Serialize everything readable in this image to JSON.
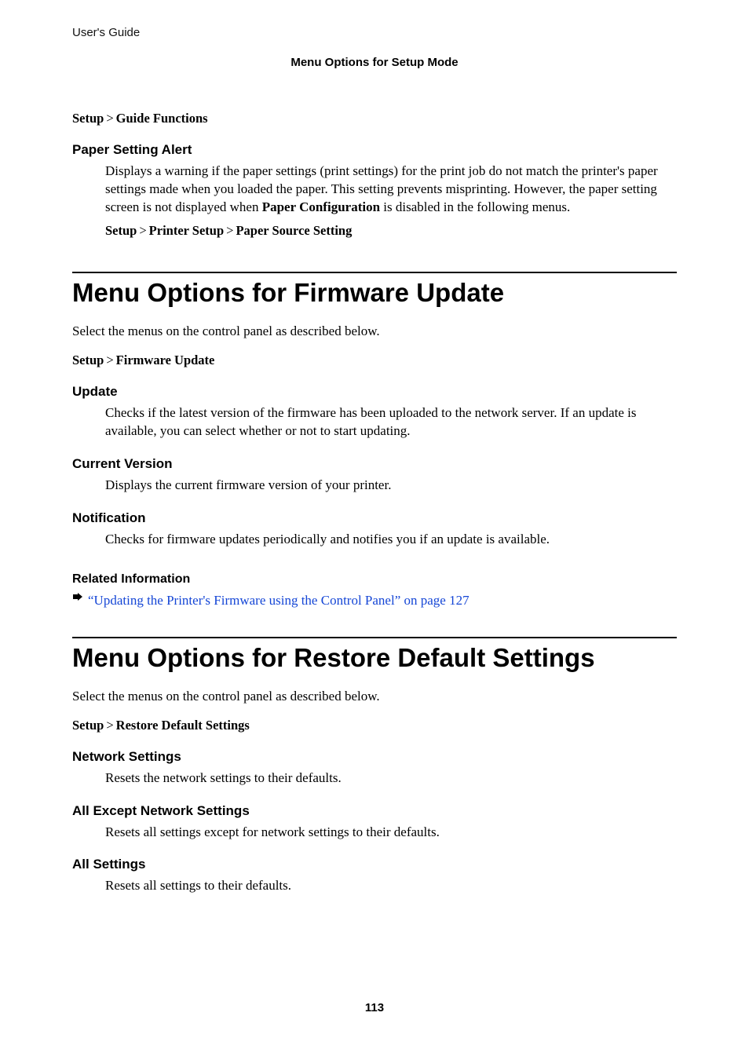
{
  "header": {
    "left": "User's Guide",
    "center": "Menu Options for Setup Mode"
  },
  "section0": {
    "path": {
      "a": "Setup",
      "b": "Guide Functions"
    },
    "item": {
      "title": "Paper Setting Alert",
      "body": "Displays a warning if the paper settings (print settings) for the print job do not match the printer's paper settings made when you loaded the paper. This setting prevents misprinting. However, the paper setting screen is not displayed when ",
      "body_bold": "Paper Configuration",
      "body_tail": " is disabled in the following menus.",
      "path": {
        "a": "Setup",
        "b": "Printer Setup",
        "c": "Paper Source Setting"
      }
    }
  },
  "section1": {
    "title": "Menu Options for Firmware Update",
    "intro": "Select the menus on the control panel as described below.",
    "path": {
      "a": "Setup",
      "b": "Firmware Update"
    },
    "items": [
      {
        "title": "Update",
        "body": "Checks if the latest version of the firmware has been uploaded to the network server. If an update is available, you can select whether or not to start updating."
      },
      {
        "title": "Current Version",
        "body": "Displays the current firmware version of your printer."
      },
      {
        "title": "Notification",
        "body": "Checks for firmware updates periodically and notifies you if an update is available."
      }
    ],
    "related": {
      "title": "Related Information",
      "link": "“Updating the Printer's Firmware using the Control Panel” on page 127"
    }
  },
  "section2": {
    "title": "Menu Options for Restore Default Settings",
    "intro": "Select the menus on the control panel as described below.",
    "path": {
      "a": "Setup",
      "b": "Restore Default Settings"
    },
    "items": [
      {
        "title": "Network Settings",
        "body": "Resets the network settings to their defaults."
      },
      {
        "title": "All Except Network Settings",
        "body": "Resets all settings except for network settings to their defaults."
      },
      {
        "title": "All Settings",
        "body": "Resets all settings to their defaults."
      }
    ]
  },
  "page_number": "113",
  "sep": ">"
}
